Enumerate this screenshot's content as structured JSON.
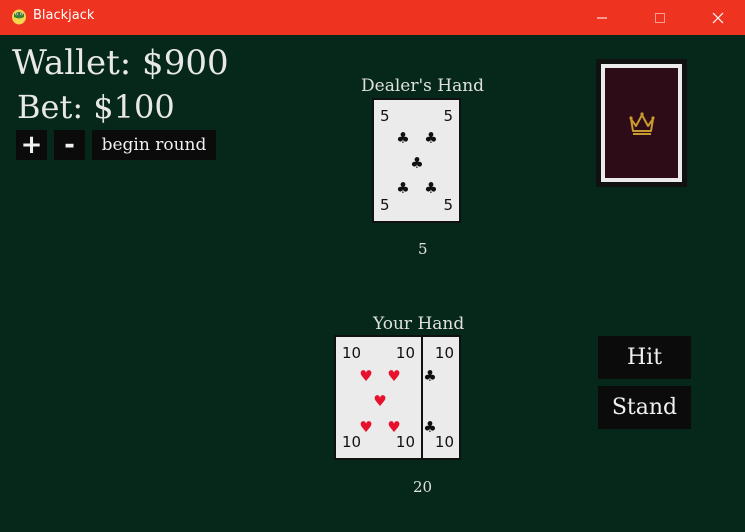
{
  "window": {
    "title": "Blackjack",
    "app_icon": "python-snake-icon",
    "controls": [
      "minimize-icon",
      "maximize-icon",
      "close-icon"
    ]
  },
  "status": {
    "wallet": "Wallet: $900",
    "bet": "Bet: $100"
  },
  "bet_controls": {
    "increase": "+",
    "decrease": "-",
    "begin": "begin round"
  },
  "dealer": {
    "label": "Dealer's Hand",
    "total": "5",
    "cards": [
      {
        "rank": "5",
        "suit": "clubs",
        "symbol": "♣",
        "color": "#111111"
      }
    ]
  },
  "player": {
    "label": "Your Hand",
    "total": "20",
    "cards": [
      {
        "rank": "10",
        "suit": "hearts",
        "symbol": "♥",
        "color": "#E8112D"
      },
      {
        "rank": "10",
        "suit": "clubs",
        "symbol": "♣",
        "color": "#111111"
      }
    ]
  },
  "deck": {
    "icon": "crown-icon",
    "back_color": "#2D0B17",
    "crown_color": "#C99A2E"
  },
  "actions": {
    "hit": "Hit",
    "stand": "Stand"
  },
  "colors": {
    "titlebar": "#EE3320",
    "table": "#05281A",
    "button": "#0B0B0B"
  }
}
